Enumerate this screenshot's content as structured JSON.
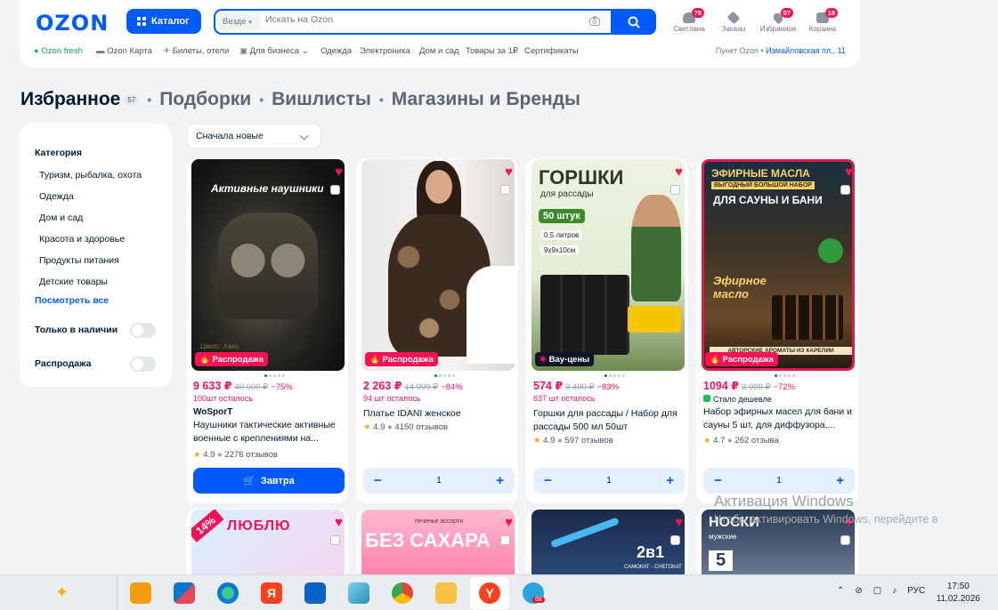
{
  "header": {
    "logo": "OZON",
    "catalog_label": "Каталог",
    "search_scope": "Везде",
    "search_placeholder": "Искать на Ozon",
    "icons": [
      {
        "label": "Светлана",
        "badge": "78",
        "icon": "user-icon"
      },
      {
        "label": "Заказы",
        "badge": "",
        "icon": "box-icon"
      },
      {
        "label": "Избранное",
        "badge": "57",
        "icon": "heart-icon"
      },
      {
        "label": "Корзина",
        "badge": "18",
        "icon": "cart-icon"
      }
    ],
    "nav": [
      "Ozon fresh",
      "Ozon Карта",
      "Билеты, отели",
      "Для бизнеса",
      "Одежда",
      "Электроника",
      "Дом и сад",
      "Товары за 1₽",
      "Сертификаты"
    ],
    "pickup_label": "Пункт Ozon •",
    "pickup_address": "Измайловская пл., 11"
  },
  "tabs": {
    "active": "Избранное",
    "count": "57",
    "others": [
      "Подборки",
      "Вишлисты",
      "Магазины и Бренды"
    ]
  },
  "filters": {
    "category_title": "Категория",
    "categories": [
      "Туризм, рыбалка, охота",
      "Одежда",
      "Дом и сад",
      "Красота и здоровье",
      "Продукты питания",
      "Детские товары"
    ],
    "show_all": "Посмотреть все",
    "in_stock": "Только в наличии",
    "sale": "Распродажа"
  },
  "sort": {
    "value": "Сначала новые"
  },
  "products": [
    {
      "image_text": "Активные наушники",
      "image_sub": "Цвет: Хаки",
      "label": "Распродажа",
      "price": "9 633 ₽",
      "old_price": "40 000 ₽",
      "discount": "−75%",
      "stock": "100шт осталось",
      "brand": "WoSporT",
      "name": "Наушники тактические активные военные с креплениями на...",
      "rating": "4.9",
      "reviews": "2276 отзывов",
      "action": "Завтра"
    },
    {
      "image_text": "",
      "label": "Распродажа",
      "price": "2 263 ₽",
      "old_price": "14 999 ₽",
      "discount": "−84%",
      "stock": "94 шт осталось",
      "name": "Платье IDANI женское",
      "rating": "4.9",
      "reviews": "4150 отзывов",
      "qty": "1"
    },
    {
      "image_text": "ГОРШКИ",
      "image_sub": "для рассады",
      "image_extra": [
        "50 штук",
        "0,5 литров",
        "9х9х10см"
      ],
      "label": "Вау-цены",
      "price": "574 ₽",
      "old_price": "3 490 ₽",
      "discount": "−83%",
      "stock": "637 шт осталось",
      "name": "Горшки для рассады / Набор для рассады 500 мл 50шт",
      "rating": "4.9",
      "reviews": "597 отзывов",
      "qty": "1"
    },
    {
      "image_text": "ЭФИРНЫЕ МАСЛА",
      "image_sub": "ВЫГОДНЫЙ БОЛЬШОЙ НАБОР",
      "image_extra": [
        "ДЛЯ САУНЫ И БАНИ",
        "Эфирное масло",
        "АВТОРСКИЕ АРОМАТЫ ИЗ КАРЕЛИИ"
      ],
      "label": "Распродажа",
      "price": "1094 ₽",
      "old_price": "3 999 ₽",
      "discount": "−72%",
      "cheaper": "Стало дешевле",
      "name": "Набор эфирных масел для бани и сауны 5 шт, для диффузора,...",
      "rating": "4.7",
      "reviews": "262 отзыва",
      "qty": "1"
    }
  ],
  "row2": [
    {
      "image_text": "ЛЮБЛЮ",
      "badge": "14%"
    },
    {
      "image_text": "БЕЗ САХАРА",
      "image_sub": "печенье ассорти"
    },
    {
      "image_text": "2в1",
      "image_sub": "САМОКАТ - СНЕГОКАТ"
    },
    {
      "image_text": "НОСКИ",
      "image_sub": "мужские",
      "image_extra": [
        "5"
      ]
    }
  ],
  "watermark": {
    "title": "Активация Windows",
    "subtitle": "Чтобы активировать Windows, перейдите в"
  },
  "taskbar": {
    "lang": "РУС",
    "time": "17:50",
    "date": "11.02.2026",
    "telegram_badge": "68"
  }
}
